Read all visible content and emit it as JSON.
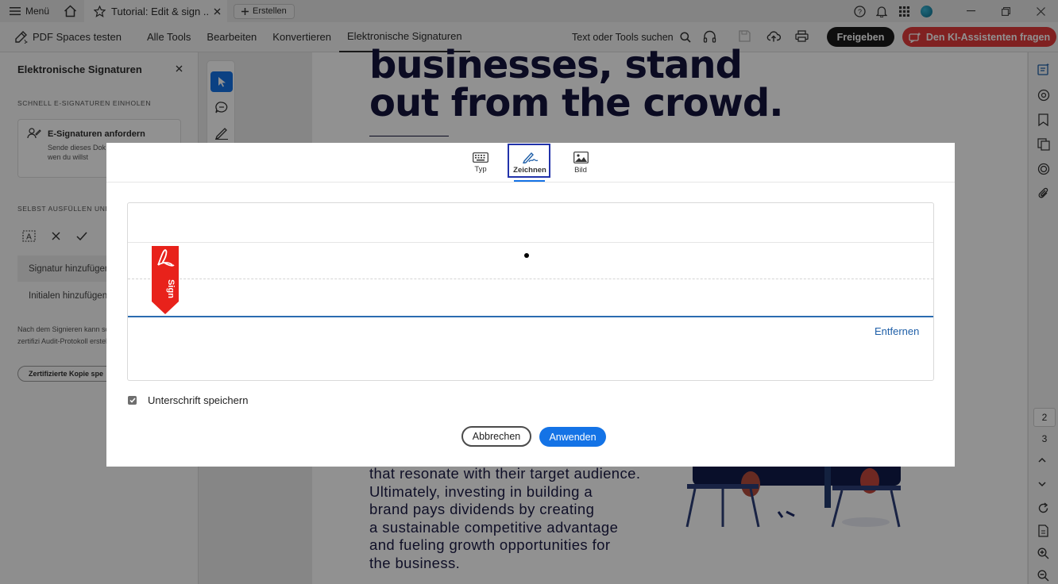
{
  "tabbar": {
    "menu_label": "Menü",
    "doc_tab_title": "Tutorial: Edit & sign ...",
    "create_label": "Erstellen"
  },
  "toolbar": {
    "spaces_label": "PDF Spaces testen",
    "menu": [
      "Alle Tools",
      "Bearbeiten",
      "Konvertieren",
      "Elektronische Signaturen"
    ],
    "active_menu_index": 3,
    "search_label": "Text oder Tools suchen",
    "share_label": "Freigeben",
    "ai_label": "Den KI-Assistenten fragen"
  },
  "left_panel": {
    "title": "Elektronische Signaturen",
    "section1": "SCHNELL E-SIGNATUREN EINHOLEN",
    "card_title": "E-Signaturen anfordern",
    "card_desc": "Sende dieses Dok einfachen E-Signa an wen du willst",
    "section2": "SELBST AUSFÜLLEN UND",
    "row_signature": "Signatur hinzufügen",
    "row_initials": "Initialen hinzufügen",
    "note": "Nach dem Signieren kann schreibgeschützte zertifizi Audit-Protokoll erstellen.",
    "cert_button": "Zertifizierte Kopie spe"
  },
  "document": {
    "headline": [
      "businesses, stand",
      "out from the crowd."
    ],
    "body": [
      "that resonate with their target audience.",
      "Ultimately, investing in building a",
      "brand pays dividends by creating",
      "a sustainable competitive advantage",
      "and fueling growth opportunities for",
      "the business."
    ]
  },
  "right_rail": {
    "page_numbers": [
      "2",
      "3"
    ]
  },
  "dialog": {
    "tabs": [
      "Typ",
      "Zeichnen",
      "Bild"
    ],
    "active_tab_index": 1,
    "remove_label": "Entfernen",
    "save_label": "Unterschrift speichern",
    "save_checked": true,
    "flag_text": "Sign",
    "cancel_label": "Abbrechen",
    "apply_label": "Anwenden"
  },
  "colors": {
    "accent": "#1473e6",
    "ai_button": "#e23a3a",
    "headline": "#14143c",
    "flag_red": "#e8221b"
  }
}
